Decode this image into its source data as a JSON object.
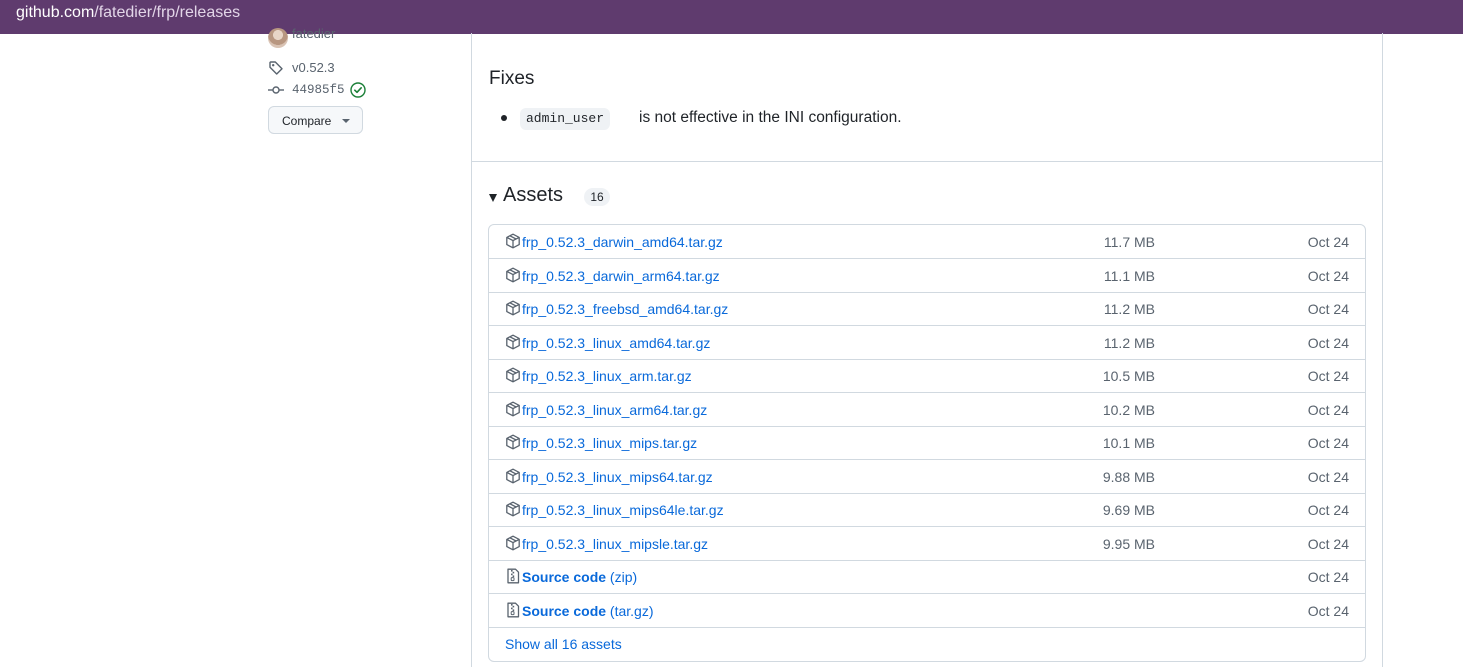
{
  "browser": {
    "url_host": "github.com",
    "url_path": "/fatedier/frp/releases"
  },
  "sidebar": {
    "author": "fatedier",
    "tag": "v0.52.3",
    "commit": "44985f5",
    "compare_label": "Compare"
  },
  "release": {
    "fixes_heading": "Fixes",
    "fixes": [
      {
        "code": "admin_user",
        "text": "is not effective in the INI configuration."
      }
    ]
  },
  "assets": {
    "heading": "Assets",
    "count": "16",
    "items": [
      {
        "name": "frp_0.52.3_darwin_amd64.tar.gz",
        "size": "11.7 MB",
        "date": "Oct 24"
      },
      {
        "name": "frp_0.52.3_darwin_arm64.tar.gz",
        "size": "11.1 MB",
        "date": "Oct 24"
      },
      {
        "name": "frp_0.52.3_freebsd_amd64.tar.gz",
        "size": "11.2 MB",
        "date": "Oct 24"
      },
      {
        "name": "frp_0.52.3_linux_amd64.tar.gz",
        "size": "11.2 MB",
        "date": "Oct 24"
      },
      {
        "name": "frp_0.52.3_linux_arm.tar.gz",
        "size": "10.5 MB",
        "date": "Oct 24"
      },
      {
        "name": "frp_0.52.3_linux_arm64.tar.gz",
        "size": "10.2 MB",
        "date": "Oct 24"
      },
      {
        "name": "frp_0.52.3_linux_mips.tar.gz",
        "size": "10.1 MB",
        "date": "Oct 24"
      },
      {
        "name": "frp_0.52.3_linux_mips64.tar.gz",
        "size": "9.88 MB",
        "date": "Oct 24"
      },
      {
        "name": "frp_0.52.3_linux_mips64le.tar.gz",
        "size": "9.69 MB",
        "date": "Oct 24"
      },
      {
        "name": "frp_0.52.3_linux_mipsle.tar.gz",
        "size": "9.95 MB",
        "date": "Oct 24"
      }
    ],
    "source": [
      {
        "label": "Source code",
        "ext": "(zip)",
        "date": "Oct 24"
      },
      {
        "label": "Source code",
        "ext": "(tar.gz)",
        "date": "Oct 24"
      }
    ],
    "show_all": "Show all 16 assets"
  },
  "colors": {
    "link": "#0969da",
    "muted": "#59636e",
    "border": "#d1d9e0",
    "urlbar": "#5f3b6e",
    "verified": "#1a7f37"
  }
}
